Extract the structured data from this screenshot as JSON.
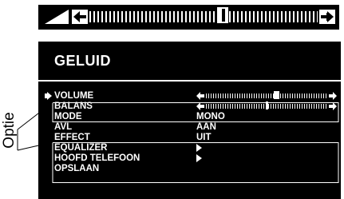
{
  "volume_bar": {
    "level": 0.58
  },
  "menu": {
    "title": "GELUID",
    "items": [
      {
        "label": "VOLUME",
        "value": "",
        "control": "slider",
        "level": 0.58,
        "selected": true
      },
      {
        "label": "BALANS",
        "value": "",
        "control": "slider",
        "level": 0.5
      },
      {
        "label": "MODE",
        "value": "MONO"
      },
      {
        "label": "AVL",
        "value": "AAN"
      },
      {
        "label": "EFFECT",
        "value": "UIT"
      },
      {
        "label": "EQUALIZER",
        "value": "",
        "control": "submenu"
      },
      {
        "label": "HOOFD TELEFOON",
        "value": "",
        "control": "submenu"
      },
      {
        "label": "OPSLAAN",
        "value": ""
      }
    ]
  },
  "callout": {
    "label": "Optie"
  },
  "colors": {
    "panel": "#000000",
    "text": "#ffffff",
    "page": "#ffffff"
  }
}
